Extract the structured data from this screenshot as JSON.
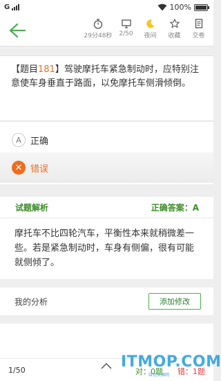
{
  "status_bar": {
    "carrier": "G",
    "battery": "100%"
  },
  "toolbar": {
    "timer": "29分48秒",
    "progress": "2/50",
    "night": "夜间",
    "favorite": "收藏",
    "submit": "交卷"
  },
  "question": {
    "number_prefix": "【题目",
    "number": "181",
    "number_suffix": "】",
    "text": "驾驶摩托车紧急制动时，应特别注意使车身垂直于路面，以免摩托车侧滑倾倒。"
  },
  "options": [
    {
      "letter": "A",
      "text": "正确"
    },
    {
      "letter": "✕",
      "text": "错误"
    }
  ],
  "explanation": {
    "title": "试题解析",
    "answer": "正确答案：A",
    "body": "摩托车不比四轮汽车，平衡性本来就稍微差一些。若是紧急制动时，车身有侧偏，很有可能就侧倾了。"
  },
  "analysis": {
    "label": "我的分析",
    "button": "添加修改"
  },
  "bottom": {
    "progress": "1/50",
    "right": "对：0题",
    "wrong": "错：1题"
  },
  "watermark": {
    "text": "ITMOP.COM",
    "sub": "绿色资源网"
  },
  "colors": {
    "accent": "#f06d1e",
    "green": "#3d8b27",
    "wrong": "#e53935"
  }
}
